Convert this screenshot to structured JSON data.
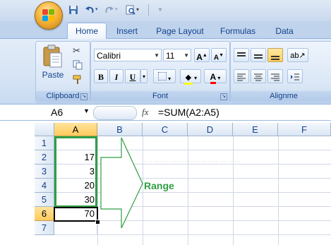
{
  "ribbon_tabs": [
    "Home",
    "Insert",
    "Page Layout",
    "Formulas",
    "Data"
  ],
  "clipboard": {
    "paste_label": "Paste",
    "group_label": "Clipboard"
  },
  "font_group": {
    "font_name": "Calibri",
    "font_size": "11",
    "group_label": "Font",
    "grow_label": "A",
    "shrink_label": "A",
    "bold_label": "B",
    "italic_label": "I",
    "underline_label": "U",
    "font_color_label": "A"
  },
  "alignment_group": {
    "group_label": "Alignme"
  },
  "formula_bar": {
    "name_box": "A6",
    "fx_label": "fx",
    "formula": "=SUM(A2:A5)"
  },
  "grid": {
    "columns": [
      "A",
      "B",
      "C",
      "D",
      "E",
      "F"
    ],
    "rows": [
      "1",
      "2",
      "3",
      "4",
      "5",
      "6",
      "7"
    ],
    "column_a_values": [
      "",
      "17",
      "3",
      "20",
      "30",
      "70",
      ""
    ]
  },
  "annotation": {
    "label": "Range",
    "color": "#2f9e44"
  },
  "colors": {
    "accent": "#15428b",
    "selection_header": "#ffcb5c",
    "range_border": "#2f9e44"
  },
  "icons": {
    "office_button": "office-logo-icon",
    "save": "save-icon",
    "undo": "undo-icon",
    "redo": "redo-icon",
    "print_preview": "print-preview-icon",
    "customize": "chevron-down-icon",
    "paste": "paste-icon",
    "cut": "scissors-icon",
    "copy": "copy-icon",
    "format_painter": "format-painter-icon",
    "borders": "borders-icon",
    "fill_color": "fill-bucket-icon"
  }
}
